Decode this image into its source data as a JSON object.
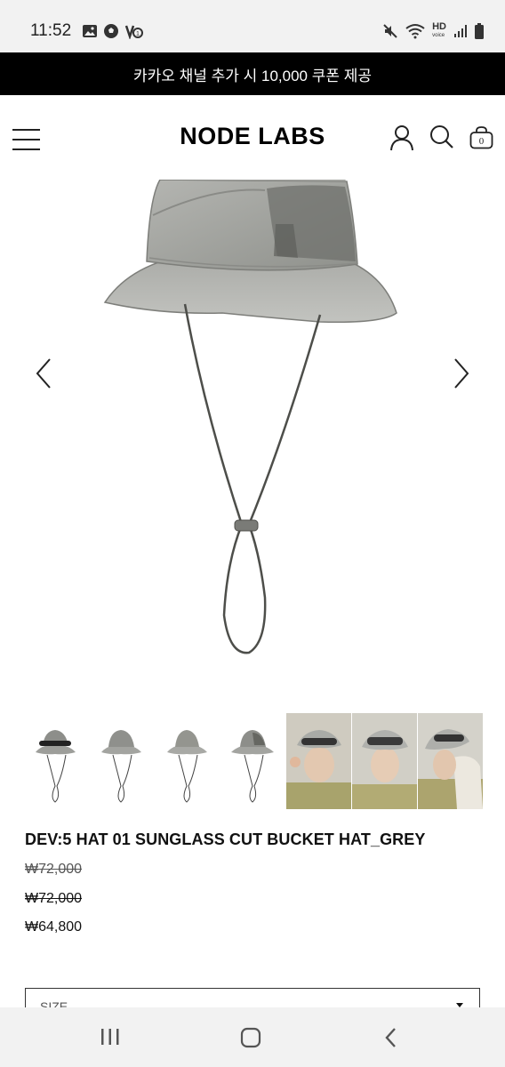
{
  "status_bar": {
    "time": "11:52",
    "hd_label": "HD",
    "voice_label": "voice"
  },
  "banner": {
    "text": "카카오 채널 추가 시 10,000 쿠폰 제공"
  },
  "header": {
    "logo": "NODE LABS",
    "cart_count": "0"
  },
  "gallery": {
    "thumbnails": [
      {
        "type": "product",
        "icon": "hat-thumbnail"
      },
      {
        "type": "product",
        "icon": "hat-thumbnail"
      },
      {
        "type": "product",
        "icon": "hat-thumbnail"
      },
      {
        "type": "product",
        "icon": "hat-thumbnail"
      },
      {
        "type": "model-photo"
      },
      {
        "type": "model-photo"
      },
      {
        "type": "model-photo"
      }
    ]
  },
  "product": {
    "title": "DEV:5 HAT 01 SUNGLASS CUT BUCKET HAT_GREY",
    "price_original_1": "₩72,000",
    "price_original_2": "₩72,000",
    "price_sale": "₩64,800"
  },
  "options": {
    "size_label": "SIZE"
  },
  "colors": {
    "banner_bg": "#000000",
    "hat_grey": "#a4a5a1",
    "status_bar_bg": "#f2f2f2"
  }
}
